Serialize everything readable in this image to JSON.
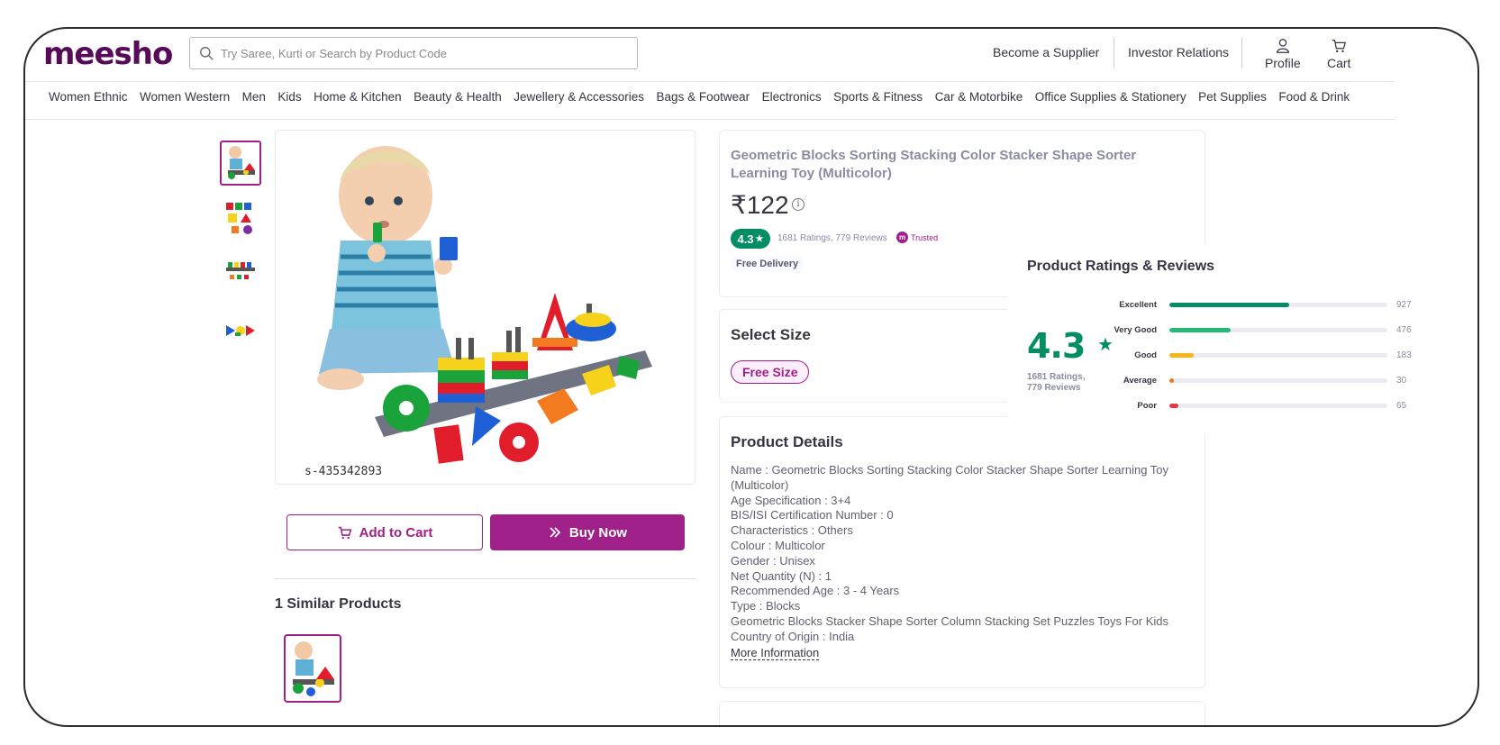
{
  "header": {
    "logo": "meesho",
    "search_placeholder": "Try Saree, Kurti or Search by Product Code",
    "links": [
      "Become a Supplier",
      "Investor Relations"
    ],
    "profile_label": "Profile",
    "cart_label": "Cart"
  },
  "categories": [
    "Women Ethnic",
    "Women Western",
    "Men",
    "Kids",
    "Home & Kitchen",
    "Beauty & Health",
    "Jewellery & Accessories",
    "Bags & Footwear",
    "Electronics",
    "Sports & Fitness",
    "Car & Motorbike",
    "Office Supplies & Stationery",
    "Pet Supplies",
    "Food & Drink"
  ],
  "product": {
    "image_code": "s-435342893",
    "title": "Geometric Blocks Sorting Stacking Color Stacker Shape Sorter Learning Toy (Multicolor)",
    "price": "₹122",
    "rating": "4.3",
    "rating_summary": "1681 Ratings, 779 Reviews",
    "trusted_label": "Trusted",
    "free_delivery": "Free Delivery"
  },
  "actions": {
    "add_to_cart": "Add to Cart",
    "buy_now": "Buy Now"
  },
  "similar": {
    "title": "1 Similar Products"
  },
  "size": {
    "title": "Select Size",
    "option": "Free Size"
  },
  "details": {
    "title": "Product Details",
    "lines": [
      "Name : Geometric Blocks Sorting Stacking Color Stacker Shape Sorter Learning Toy (Multicolor)",
      "Age Specification : 3+4",
      "BIS/ISI Certification Number : 0",
      "Characteristics : Others",
      "Colour : Multicolor",
      "Gender : Unisex",
      "Net Quantity (N) : 1",
      "Recommended Age : 3 - 4 Years",
      "Type : Blocks",
      "Geometric Blocks Stacker Shape Sorter Column Stacking Set Puzzles Toys For Kids",
      "Country of Origin : India"
    ],
    "more": "More Information"
  },
  "reviews": {
    "title": "Product Ratings & Reviews",
    "average": "4.3",
    "count_line1": "1681 Ratings,",
    "count_line2": "779 Reviews",
    "bars": [
      {
        "label": "Excellent",
        "count": 927,
        "fraction": 0.55,
        "color": "#038d63"
      },
      {
        "label": "Very Good",
        "count": 476,
        "fraction": 0.28,
        "color": "#23bb75"
      },
      {
        "label": "Good",
        "count": 183,
        "fraction": 0.11,
        "color": "#f4b619"
      },
      {
        "label": "Average",
        "count": 30,
        "fraction": 0.018,
        "color": "#e97d1e"
      },
      {
        "label": "Poor",
        "count": 65,
        "fraction": 0.04,
        "color": "#e23945"
      }
    ]
  },
  "colors": {
    "brand": "#570a57",
    "accent": "#9f2089",
    "rating_green": "#038d63"
  }
}
